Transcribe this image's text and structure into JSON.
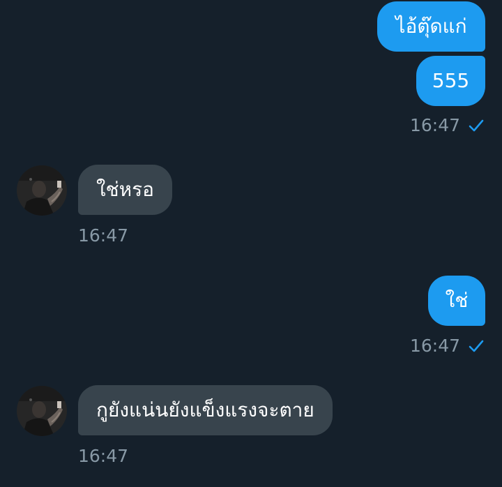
{
  "messages": [
    {
      "id": 1,
      "direction": "outgoing",
      "text": "ไอ้ตุ๊ดแก่"
    },
    {
      "id": 2,
      "direction": "outgoing",
      "text": "555",
      "time": "16:47",
      "status": "sent-check-icon"
    },
    {
      "id": 3,
      "direction": "incoming",
      "text": "ใช่หรอ",
      "time": "16:47"
    },
    {
      "id": 4,
      "direction": "outgoing",
      "text": "ใช่",
      "time": "16:47",
      "status": "sent-check-icon"
    },
    {
      "id": 5,
      "direction": "incoming",
      "text": "กูยังแน่นยังแข็งแรงจะตาย",
      "time": "16:47"
    }
  ],
  "colors": {
    "background": "#15202b",
    "outgoing_bubble": "#1d9bf0",
    "incoming_bubble": "#38444d",
    "timestamp": "#8899a6",
    "check": "#1d9bf0"
  }
}
